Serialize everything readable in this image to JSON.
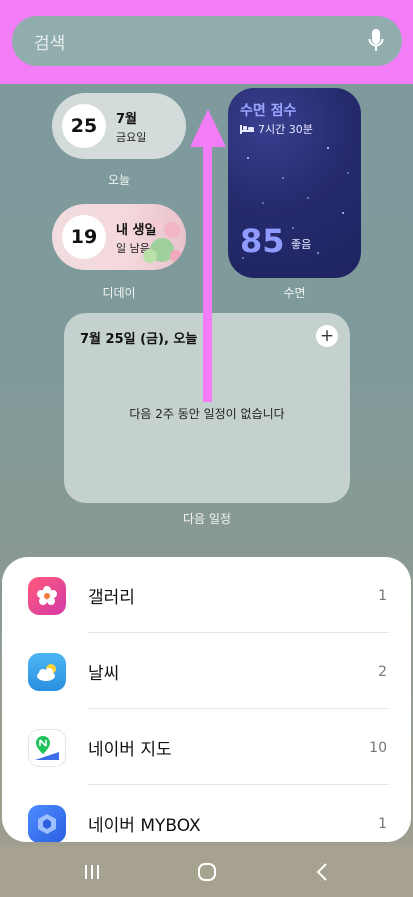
{
  "search": {
    "placeholder": "검색"
  },
  "widgets": {
    "calendar_today": {
      "day": "25",
      "month": "7월",
      "weekday": "금요일",
      "caption": "오늘"
    },
    "dday": {
      "day": "19",
      "title": "내 생일",
      "subtitle": "일 남음",
      "caption": "디데이"
    },
    "sleep": {
      "title": "수면 점수",
      "duration": "7시간 30분",
      "score": "85",
      "grade": "좋음",
      "caption": "수면"
    },
    "schedule": {
      "date": "7월 25일 (금), 오늘",
      "add": "+",
      "empty": "다음 2주 동안 일정이 없습니다",
      "caption": "다음 일정"
    }
  },
  "apps": [
    {
      "name": "갤러리",
      "count": "1",
      "icon": "gallery-icon"
    },
    {
      "name": "날씨",
      "count": "2",
      "icon": "weather-icon"
    },
    {
      "name": "네이버 지도",
      "count": "10",
      "icon": "naver-map-icon"
    },
    {
      "name": "네이버 MYBOX",
      "count": "1",
      "icon": "naver-mybox-icon"
    }
  ],
  "colors": {
    "highlight": "#f27df7",
    "sleep_accent": "#8f9bff"
  }
}
